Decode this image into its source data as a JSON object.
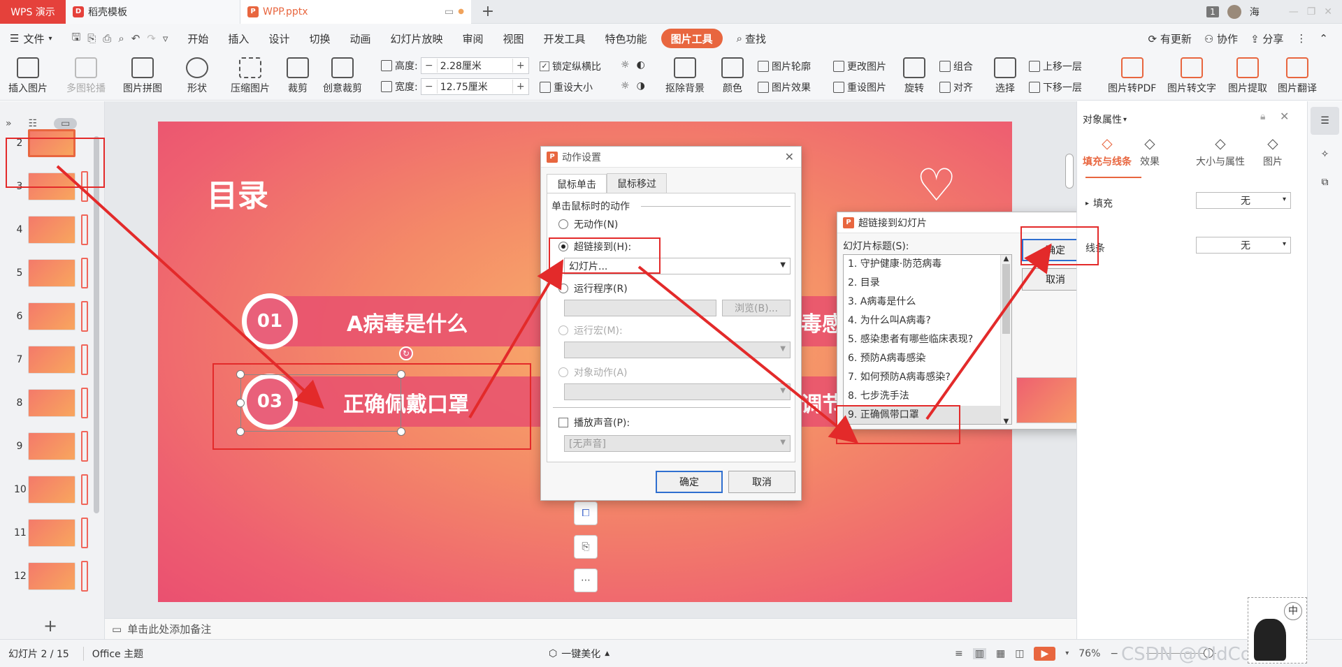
{
  "titlebar": {
    "tabs": [
      {
        "label": "WPS 演示"
      },
      {
        "label": "稻壳模板"
      },
      {
        "label": "WPP.pptx"
      }
    ],
    "page_badge": "1",
    "user_name": "海"
  },
  "menu": {
    "file": "文件",
    "items": [
      "开始",
      "插入",
      "设计",
      "切换",
      "动画",
      "幻灯片放映",
      "审阅",
      "视图",
      "开发工具",
      "特色功能"
    ],
    "active_tool": "图片工具",
    "search": "查找",
    "right": [
      "有更新",
      "协作",
      "分享"
    ]
  },
  "ribbon": {
    "insert_image": "插入图片",
    "carousel": "多图轮播",
    "collage": "图片拼图",
    "shape": "形状",
    "compress": "压缩图片",
    "crop": "裁剪",
    "creative_crop": "创意裁剪",
    "height_label": "高度:",
    "height_value": "2.28厘米",
    "width_label": "宽度:",
    "width_value": "12.75厘米",
    "lock_ratio": "锁定纵横比",
    "reset_size": "重设大小",
    "remove_bg": "抠除背景",
    "color": "颜色",
    "outline": "图片轮廓",
    "effect": "图片效果",
    "change_pic": "更改图片",
    "reset_pic": "重设图片",
    "rotate": "旋转",
    "group": "组合",
    "align": "对齐",
    "select": "选择",
    "bring_forward": "上移一层",
    "send_backward": "下移一层",
    "to_pdf": "图片转PDF",
    "to_text": "图片转文字",
    "extract": "图片提取",
    "translate": "图片翻译"
  },
  "slides": {
    "numbers": [
      "2",
      "3",
      "4",
      "5",
      "6",
      "7",
      "8",
      "9",
      "10",
      "11",
      "12"
    ]
  },
  "slide": {
    "title": "目录",
    "items": [
      {
        "num": "01",
        "text": "A病毒是什么"
      },
      {
        "num": "03",
        "text": "正确佩戴口罩"
      }
    ],
    "partial_right_1": "毒感",
    "partial_right_2": "调节"
  },
  "action_dialog": {
    "title": "动作设置",
    "tabs": [
      "鼠标单击",
      "鼠标移过"
    ],
    "section": "单击鼠标时的动作",
    "none": "无动作(N)",
    "hyperlink": "超链接到(H):",
    "hyperlink_value": "幻灯片...",
    "run_program": "运行程序(R)",
    "browse": "浏览(B)...",
    "run_macro": "运行宏(M):",
    "object_action": "对象动作(A)",
    "play_sound": "播放声音(P):",
    "sound_value": "[无声音]",
    "ok": "确定",
    "cancel": "取消"
  },
  "link_dialog": {
    "title": "超链接到幻灯片",
    "list_label": "幻灯片标题(S):",
    "items": [
      "1. 守护健康·防范病毒",
      "2. 目录",
      "3. A病毒是什么",
      "4. 为什么叫A病毒?",
      "5. 感染患者有哪些临床表现?",
      "6. 预防A病毒感染",
      "7. 如何预防A病毒感染?",
      "8. 七步洗手法",
      "9. 正确佩带口罩"
    ],
    "ok": "确定",
    "cancel": "取消"
  },
  "right_panel": {
    "title": "对象属性",
    "tabs": [
      "填充与线条",
      "效果",
      "大小与属性",
      "图片"
    ],
    "fill_label": "填充",
    "fill_value": "无",
    "line_label": "线条",
    "line_value": "无"
  },
  "notes": {
    "placeholder": "单击此处添加备注"
  },
  "status": {
    "slide_info": "幻灯片 2 / 15",
    "theme": "Office 主题",
    "beautify": "一键美化",
    "zoom": "76%",
    "watermark": "CSDN @OldCorrect",
    "ime": "中"
  },
  "colors": {
    "accent": "#e8663f",
    "annotation_red": "#e32a2a",
    "wps_red": "#e5413b"
  }
}
